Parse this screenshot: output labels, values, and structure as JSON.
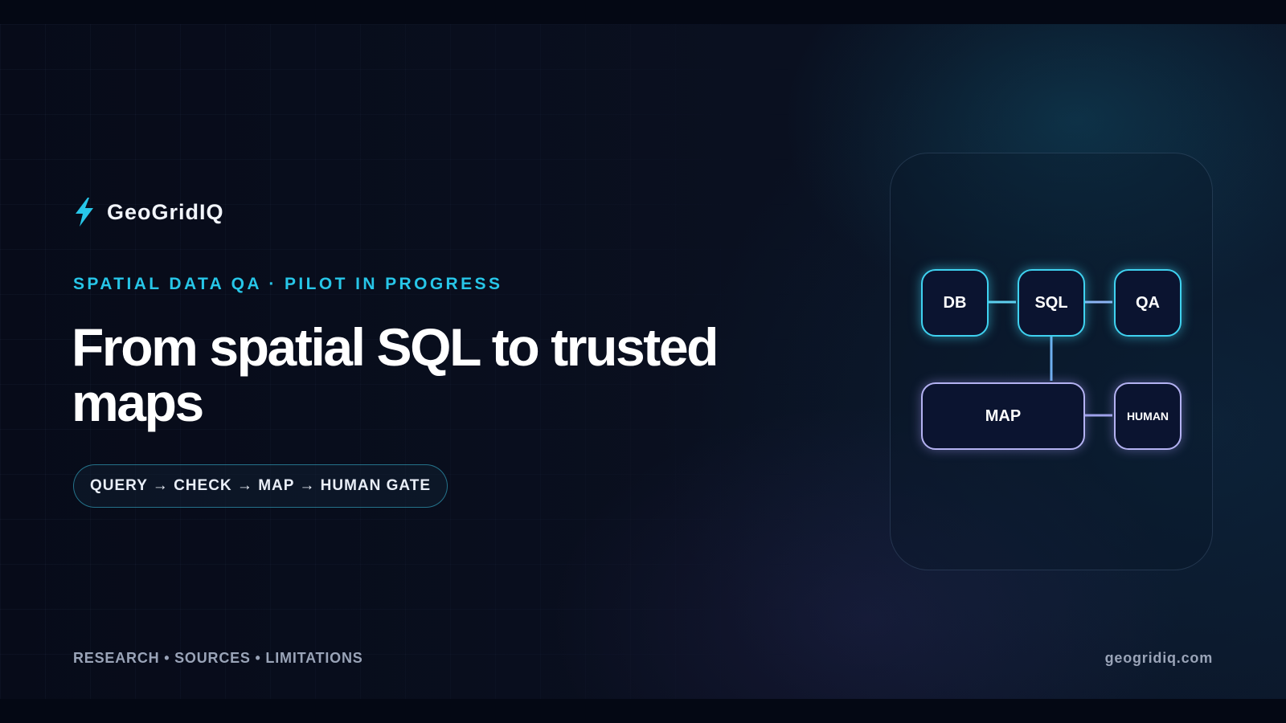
{
  "brand": {
    "name": "GeoGridIQ",
    "icon": "lightning-bolt-icon",
    "icon_color": "#27c6e8"
  },
  "kicker": "SPATIAL DATA QA · PILOT IN PROGRESS",
  "headline": "From spatial SQL to trusted maps",
  "pipeline_pill": "QUERY → CHECK → MAP → HUMAN GATE",
  "diagram": {
    "nodes": {
      "db": "DB",
      "sql": "SQL",
      "qa": "QA",
      "map": "MAP",
      "human": "HUMAN"
    },
    "colors": {
      "cyan": "#3fd2f0",
      "violet": "#b4b2f2",
      "connector_blue": "#6fb0f0"
    }
  },
  "footer": {
    "left": "RESEARCH • SOURCES • LIMITATIONS",
    "right": "geogridiq.com"
  },
  "colors": {
    "background": "#070b19",
    "accent": "#27c6e8",
    "text": "#ffffff",
    "muted": "#9aa4b8"
  }
}
